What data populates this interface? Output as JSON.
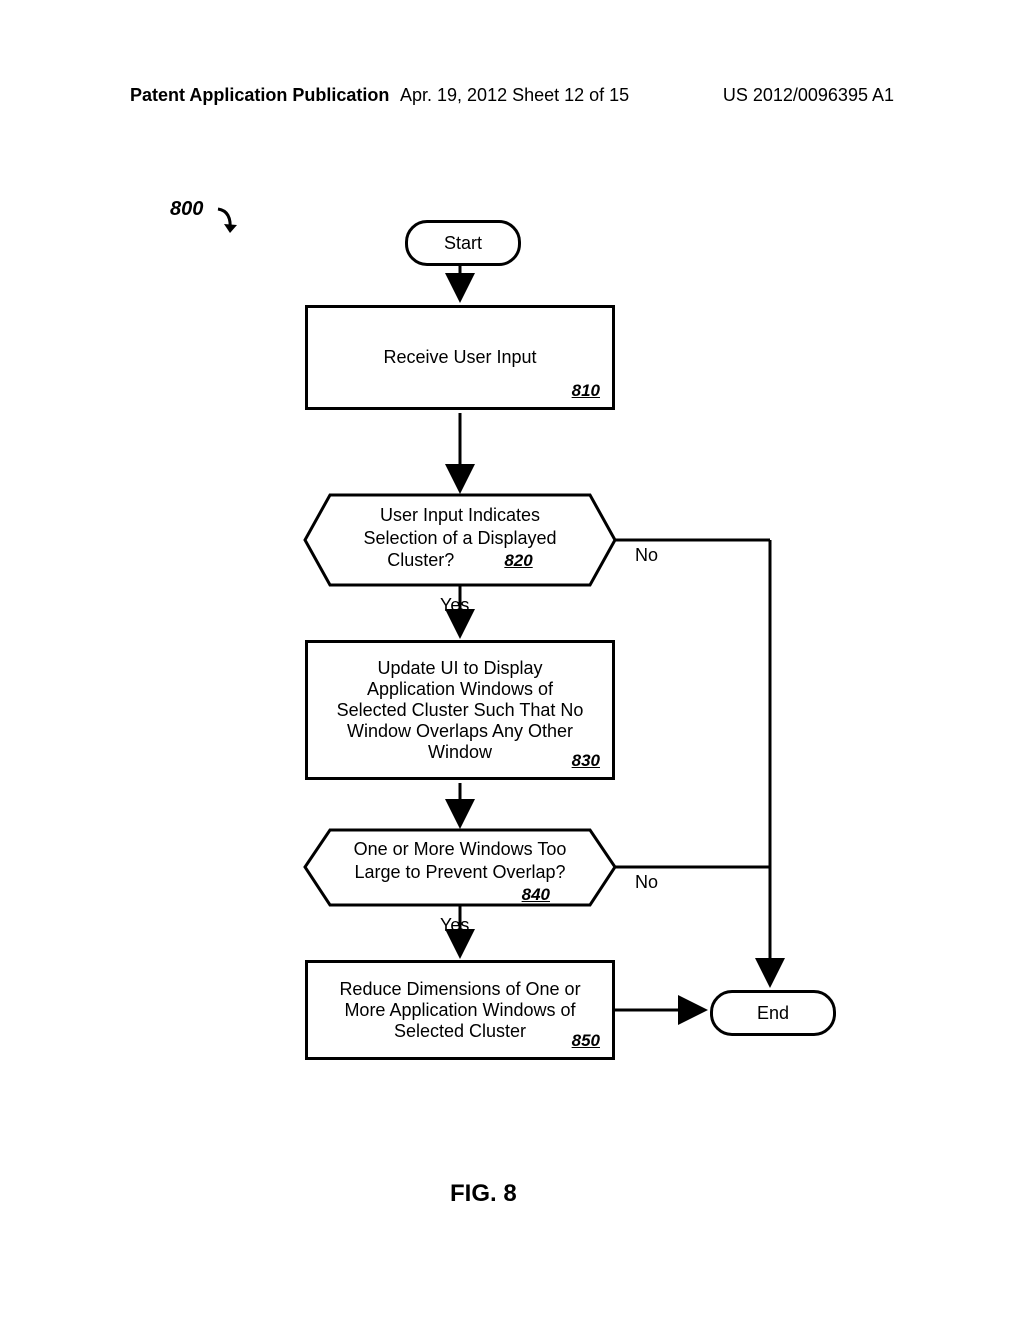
{
  "header": {
    "left": "Patent Application Publication",
    "mid": "Apr. 19, 2012  Sheet 12 of 15",
    "right": "US 2012/0096395 A1"
  },
  "figlabel": "800",
  "start": "Start",
  "end": "End",
  "step810": {
    "text": "Receive User Input",
    "ref": "810"
  },
  "step820": {
    "line1": "User Input Indicates",
    "line2": "Selection of a Displayed",
    "line3": "Cluster?",
    "ref": "820"
  },
  "step830": {
    "line1": "Update UI to Display",
    "line2": "Application Windows of",
    "line3": "Selected Cluster Such That No",
    "line4": "Window Overlaps Any Other",
    "line5": "Window",
    "ref": "830"
  },
  "step840": {
    "line1": "One or More Windows Too",
    "line2": "Large to Prevent Overlap?",
    "ref": "840"
  },
  "step850": {
    "line1": "Reduce Dimensions of One or",
    "line2": "More Application Windows of",
    "line3": "Selected Cluster",
    "ref": "850"
  },
  "labels": {
    "yes": "Yes",
    "no": "No"
  },
  "caption": "FIG. 8"
}
